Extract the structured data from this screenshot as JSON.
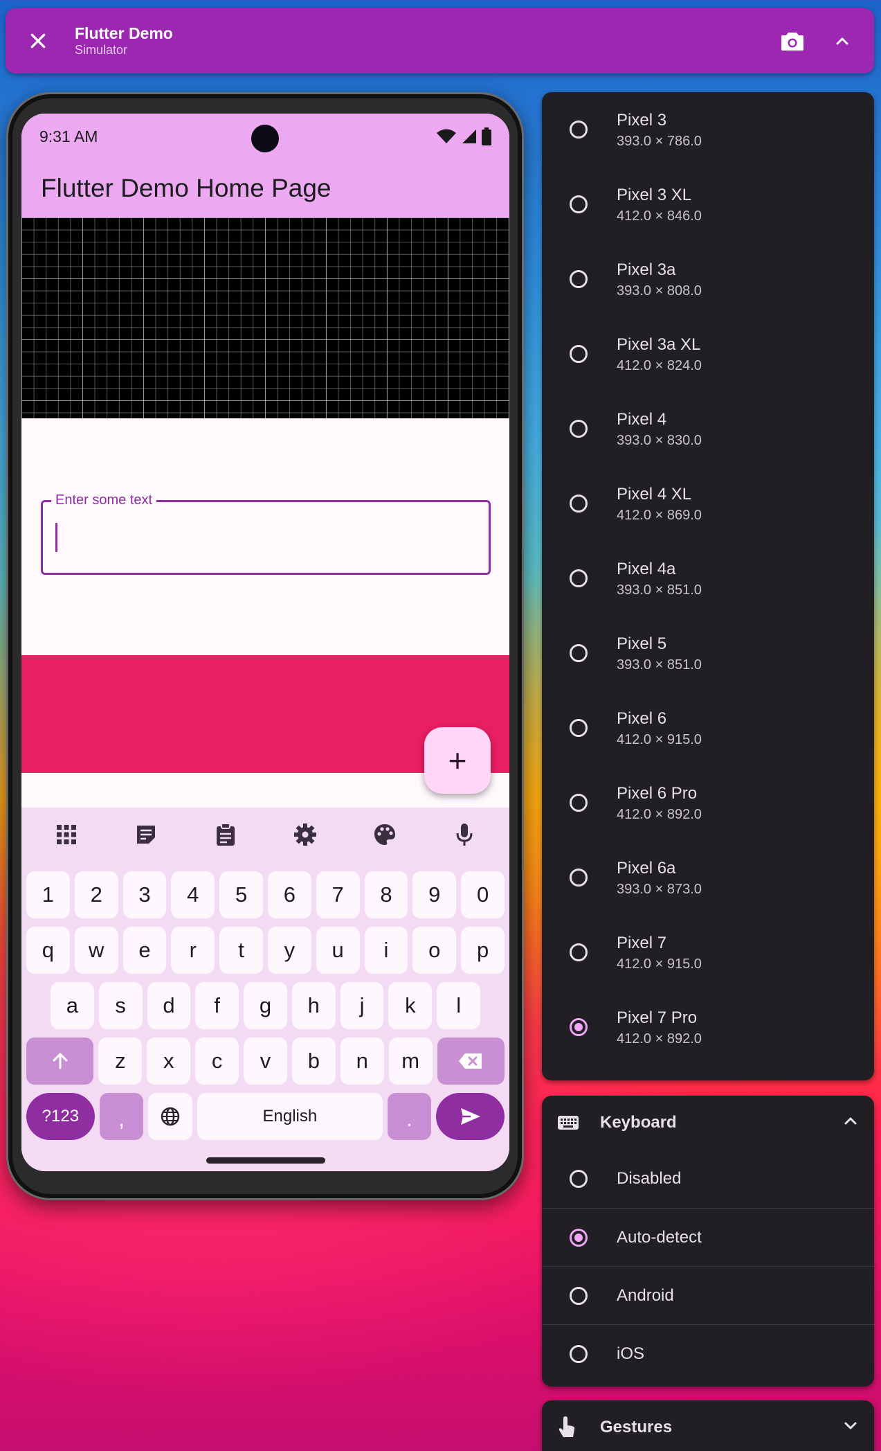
{
  "window": {
    "title": "Flutter Demo",
    "subtitle": "Simulator"
  },
  "phone": {
    "status_time": "9:31 AM",
    "app_title": "Flutter Demo Home Page",
    "text_field_label": "Enter some text",
    "fab_label": "+",
    "keyboard": {
      "toolbar_icons": [
        "apps-icon",
        "sticky-note-icon",
        "clipboard-icon",
        "settings-icon",
        "palette-icon",
        "microphone-icon"
      ],
      "number_row": [
        "1",
        "2",
        "3",
        "4",
        "5",
        "6",
        "7",
        "8",
        "9",
        "0"
      ],
      "row1": [
        "q",
        "w",
        "e",
        "r",
        "t",
        "y",
        "u",
        "i",
        "o",
        "p"
      ],
      "row2": [
        "a",
        "s",
        "d",
        "f",
        "g",
        "h",
        "j",
        "k",
        "l"
      ],
      "row3": [
        "z",
        "x",
        "c",
        "v",
        "b",
        "n",
        "m"
      ],
      "symbols_label": "?123",
      "comma": ",",
      "space_label": "English",
      "period": "."
    }
  },
  "devices": [
    {
      "name": "Pixel 3",
      "size": "393.0 × 786.0",
      "selected": false
    },
    {
      "name": "Pixel 3 XL",
      "size": "412.0 × 846.0",
      "selected": false
    },
    {
      "name": "Pixel 3a",
      "size": "393.0 × 808.0",
      "selected": false
    },
    {
      "name": "Pixel 3a XL",
      "size": "412.0 × 824.0",
      "selected": false
    },
    {
      "name": "Pixel 4",
      "size": "393.0 × 830.0",
      "selected": false
    },
    {
      "name": "Pixel 4 XL",
      "size": "412.0 × 869.0",
      "selected": false
    },
    {
      "name": "Pixel 4a",
      "size": "393.0 × 851.0",
      "selected": false
    },
    {
      "name": "Pixel 5",
      "size": "393.0 × 851.0",
      "selected": false
    },
    {
      "name": "Pixel 6",
      "size": "412.0 × 915.0",
      "selected": false
    },
    {
      "name": "Pixel 6 Pro",
      "size": "412.0 × 892.0",
      "selected": false
    },
    {
      "name": "Pixel 6a",
      "size": "393.0 × 873.0",
      "selected": false
    },
    {
      "name": "Pixel 7",
      "size": "412.0 × 915.0",
      "selected": false
    },
    {
      "name": "Pixel 7 Pro",
      "size": "412.0 × 892.0",
      "selected": true
    }
  ],
  "keyboard_panel": {
    "title": "Keyboard",
    "options": [
      {
        "label": "Disabled",
        "selected": false
      },
      {
        "label": "Auto-detect",
        "selected": true
      },
      {
        "label": "Android",
        "selected": false
      },
      {
        "label": "iOS",
        "selected": false
      }
    ]
  },
  "gestures_panel": {
    "title": "Gestures"
  },
  "colors": {
    "topbar": "#9c27b0",
    "app_bar": "#eca8f1",
    "accent": "#f0a6f6",
    "panel_bg": "#211f24",
    "pink_block": "#e91e63"
  }
}
